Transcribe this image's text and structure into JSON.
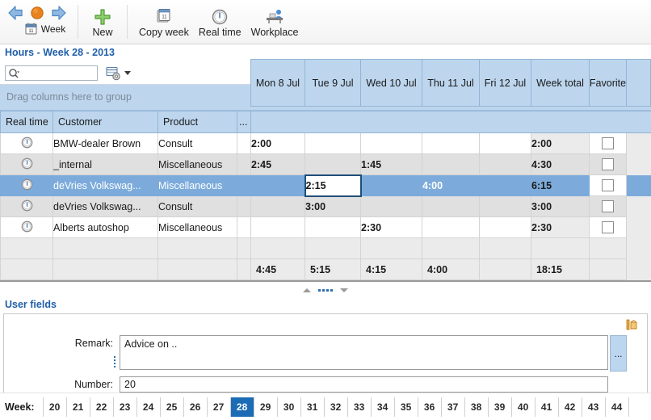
{
  "toolbar": {
    "nav": {
      "back_icon": "back-arrow-icon",
      "stop_icon": "orange-circle-icon",
      "forward_icon": "forward-arrow-icon"
    },
    "items": [
      {
        "label": "Week",
        "icon": "calendar-icon"
      },
      {
        "label": "New",
        "icon": "plus-icon"
      },
      {
        "label": "Copy week",
        "icon": "copy-calendar-icon"
      },
      {
        "label": "Real time",
        "icon": "clock-icon"
      },
      {
        "label": "Workplace",
        "icon": "workplace-icon"
      }
    ]
  },
  "title": {
    "module": "Hours",
    "week": "Week 28",
    "year": "2013",
    "full": "Hours - Week 28 - 2013"
  },
  "search": {
    "value": "",
    "placeholder": "",
    "icon": "search-icon",
    "settings_icon": "grid-settings-icon"
  },
  "grid": {
    "group_panel_text": "Drag columns here to group",
    "columns": [
      {
        "key": "realtime",
        "label": "Real time"
      },
      {
        "key": "customer",
        "label": "Customer"
      },
      {
        "key": "product",
        "label": "Product"
      },
      {
        "key": "more",
        "label": "..."
      },
      {
        "key": "mon",
        "label": "Mon 8 Jul"
      },
      {
        "key": "tue",
        "label": "Tue 9 Jul"
      },
      {
        "key": "wed",
        "label": "Wed 10 Jul"
      },
      {
        "key": "thu",
        "label": "Thu 11 Jul"
      },
      {
        "key": "fri",
        "label": "Fri 12 Jul"
      },
      {
        "key": "total",
        "label": "Week total"
      },
      {
        "key": "fav",
        "label": "Favorite"
      },
      {
        "key": "tail",
        "label": ""
      }
    ],
    "rows": [
      {
        "realtime_icon": "stopwatch-icon",
        "customer": "BMW-dealer Brown",
        "product": "Consult",
        "more": "",
        "mon": "2:00",
        "tue": "",
        "wed": "",
        "thu": "",
        "fri": "",
        "total": "2:00",
        "favorite": false,
        "selected": false,
        "alt": false
      },
      {
        "realtime_icon": "stopwatch-icon",
        "customer": "_internal",
        "product": "Miscellaneous",
        "more": "",
        "mon": "2:45",
        "tue": "",
        "wed": "1:45",
        "thu": "",
        "fri": "",
        "total": "4:30",
        "favorite": false,
        "selected": false,
        "alt": true
      },
      {
        "realtime_icon": "stopwatch-icon",
        "customer": "deVries Volkswag...",
        "product": "Miscellaneous",
        "more": "",
        "mon": "",
        "tue": "2:15",
        "wed": "",
        "thu": "4:00",
        "fri": "",
        "total": "6:15",
        "favorite": false,
        "selected": true,
        "focused_cell": "tue",
        "alt": false
      },
      {
        "realtime_icon": "stopwatch-icon",
        "customer": "deVries Volkswag...",
        "product": "Consult",
        "more": "",
        "mon": "",
        "tue": "3:00",
        "wed": "",
        "thu": "",
        "fri": "",
        "total": "3:00",
        "favorite": false,
        "selected": false,
        "alt": true
      },
      {
        "realtime_icon": "stopwatch-icon",
        "customer": "Alberts autoshop",
        "product": "Miscellaneous",
        "more": "",
        "mon": "",
        "tue": "",
        "wed": "2:30",
        "thu": "",
        "fri": "",
        "total": "2:30",
        "favorite": false,
        "selected": false,
        "alt": false
      }
    ],
    "totals": {
      "mon": "4:45",
      "tue": "5:15",
      "wed": "4:15",
      "thu": "4:00",
      "fri": "",
      "total": "18:15"
    }
  },
  "splitter": {
    "up_icon": "triangle-up-icon",
    "dots_icon": "grip-dots-icon",
    "down_icon": "triangle-down-icon"
  },
  "user_fields": {
    "title": "User fields",
    "copy_icon": "copy-clipboard-icon",
    "remark_label": "Remark:",
    "remark_value": "Advice on ..",
    "ellipsis_button": "...",
    "number_label": "Number:",
    "number_value": "20"
  },
  "weekbar": {
    "label": "Week:",
    "active": "28",
    "weeks": [
      "20",
      "21",
      "22",
      "23",
      "24",
      "25",
      "26",
      "27",
      "28",
      "29",
      "30",
      "31",
      "32",
      "33",
      "34",
      "35",
      "36",
      "37",
      "38",
      "39",
      "40",
      "41",
      "42",
      "43",
      "44"
    ]
  },
  "colors": {
    "accent_blue": "#1f5fa9",
    "header_blue": "#bdd6ee",
    "selection_blue": "#7cabdb",
    "active_week_blue": "#1b6cb5"
  }
}
